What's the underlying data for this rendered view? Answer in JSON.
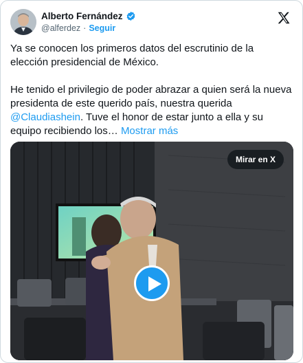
{
  "author": {
    "name": "Alberto Fernández",
    "handle": "@alferdez",
    "separator": "·",
    "follow_label": "Seguir",
    "verified": true,
    "avatar_icon": "avatar-photo"
  },
  "brand": {
    "icon": "x-logo-icon",
    "accent": "#1d9bf0"
  },
  "tweet": {
    "paragraph1": "Ya se conocen los primeros datos del escrutinio de la elección presidencial de México.",
    "paragraph2_start": "He tenido el privilegio de poder abrazar a quien será la nueva presidenta de este querido país, nuestra querida ",
    "mention": "@Claudiashein",
    "paragraph2_end": ". Tuve el honor de estar junto a ella y su equipo recibiendo los… ",
    "show_more": "Mostrar más"
  },
  "media": {
    "watch_label": "Mirar en X",
    "play_icon": "play-icon"
  }
}
